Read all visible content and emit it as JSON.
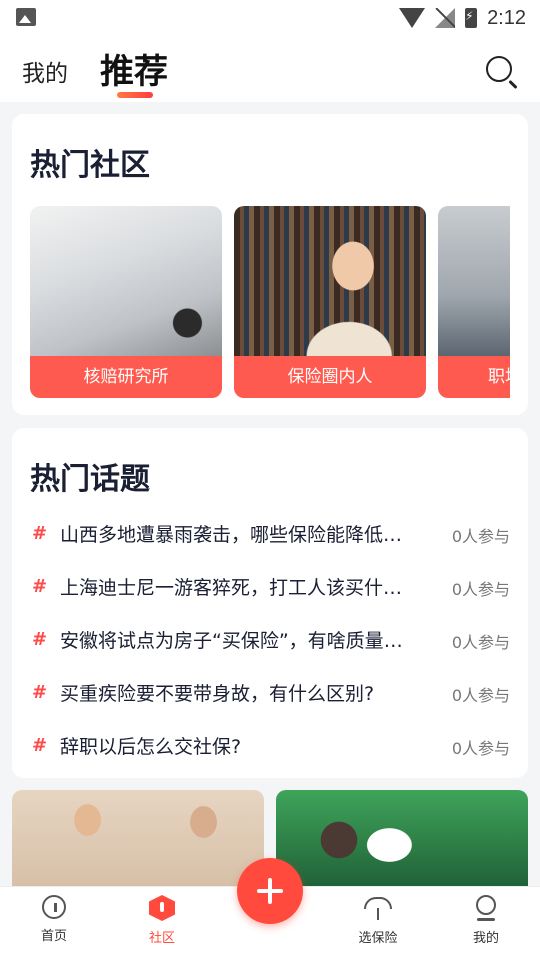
{
  "status_bar": {
    "time": "2:12"
  },
  "top_nav": {
    "tab_mine": "我的",
    "tab_recommend": "推荐"
  },
  "hot_community": {
    "title": "热门社区",
    "items": [
      {
        "label": "核赔研究所"
      },
      {
        "label": "保险圈内人"
      },
      {
        "label": "职场"
      }
    ]
  },
  "hot_topics": {
    "title": "热门话题",
    "hash": "#",
    "items": [
      {
        "text": "山西多地遭暴雨袭击，哪些保险能降低损失？",
        "count": "0人参与"
      },
      {
        "text": "上海迪士尼一游客猝死，打工人该买什么保险？",
        "count": "0人参与"
      },
      {
        "text": "安徽将试点为房子“买保险”，有啥质量问题？",
        "count": "0人参与"
      },
      {
        "text": "买重疾险要不要带身故，有什么区别?",
        "count": "0人参与"
      },
      {
        "text": "辞职以后怎么交社保?",
        "count": "0人参与"
      }
    ]
  },
  "bottom_nav": {
    "items": [
      {
        "label": "首页"
      },
      {
        "label": "社区"
      },
      {
        "label": "选保险"
      },
      {
        "label": "我的"
      }
    ]
  }
}
